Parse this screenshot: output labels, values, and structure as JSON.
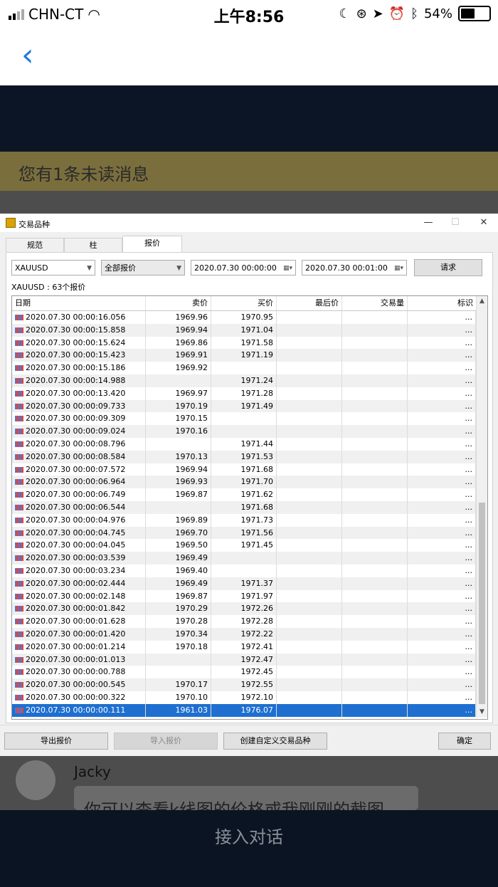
{
  "status": {
    "carrier": "CHN-CT",
    "time": "上午8:56",
    "battery": "54%",
    "battery_level": 0.54
  },
  "chat": {
    "banner": "您有1条未读消息",
    "username": "Jacky",
    "message": "你可以查看k线图的价格或我刚刚的截图",
    "bottom_action": "接入对话"
  },
  "dialog": {
    "title": "交易品种",
    "tabs": [
      {
        "label": "规范",
        "active": false
      },
      {
        "label": "柱",
        "active": false
      },
      {
        "label": "报价",
        "active": true
      }
    ],
    "symbol": "XAUUSD",
    "quote_type": "全部报价",
    "date_from": "2020.07.30 00:00:00",
    "date_to": "2020.07.30 00:01:00",
    "request_label": "请求",
    "count_text": "XAUUSD : 63个报价",
    "columns": [
      "日期",
      "卖价",
      "买价",
      "最后价",
      "交易量",
      "标识"
    ],
    "rows": [
      {
        "date": "2020.07.30 00:00:16.056",
        "bid": "1969.96",
        "ask": "1970.95",
        "flag": "..."
      },
      {
        "date": "2020.07.30 00:00:15.858",
        "bid": "1969.94",
        "ask": "1971.04",
        "flag": "..."
      },
      {
        "date": "2020.07.30 00:00:15.624",
        "bid": "1969.86",
        "ask": "1971.58",
        "flag": "..."
      },
      {
        "date": "2020.07.30 00:00:15.423",
        "bid": "1969.91",
        "ask": "1971.19",
        "flag": "..."
      },
      {
        "date": "2020.07.30 00:00:15.186",
        "bid": "1969.92",
        "ask": "",
        "flag": "..."
      },
      {
        "date": "2020.07.30 00:00:14.988",
        "bid": "",
        "ask": "1971.24",
        "flag": "..."
      },
      {
        "date": "2020.07.30 00:00:13.420",
        "bid": "1969.97",
        "ask": "1971.28",
        "flag": "..."
      },
      {
        "date": "2020.07.30 00:00:09.733",
        "bid": "1970.19",
        "ask": "1971.49",
        "flag": "..."
      },
      {
        "date": "2020.07.30 00:00:09.309",
        "bid": "1970.15",
        "ask": "",
        "flag": "..."
      },
      {
        "date": "2020.07.30 00:00:09.024",
        "bid": "1970.16",
        "ask": "",
        "flag": "..."
      },
      {
        "date": "2020.07.30 00:00:08.796",
        "bid": "",
        "ask": "1971.44",
        "flag": "..."
      },
      {
        "date": "2020.07.30 00:00:08.584",
        "bid": "1970.13",
        "ask": "1971.53",
        "flag": "..."
      },
      {
        "date": "2020.07.30 00:00:07.572",
        "bid": "1969.94",
        "ask": "1971.68",
        "flag": "..."
      },
      {
        "date": "2020.07.30 00:00:06.964",
        "bid": "1969.93",
        "ask": "1971.70",
        "flag": "..."
      },
      {
        "date": "2020.07.30 00:00:06.749",
        "bid": "1969.87",
        "ask": "1971.62",
        "flag": "..."
      },
      {
        "date": "2020.07.30 00:00:06.544",
        "bid": "",
        "ask": "1971.68",
        "flag": "..."
      },
      {
        "date": "2020.07.30 00:00:04.976",
        "bid": "1969.89",
        "ask": "1971.73",
        "flag": "..."
      },
      {
        "date": "2020.07.30 00:00:04.745",
        "bid": "1969.70",
        "ask": "1971.56",
        "flag": "..."
      },
      {
        "date": "2020.07.30 00:00:04.045",
        "bid": "1969.50",
        "ask": "1971.45",
        "flag": "..."
      },
      {
        "date": "2020.07.30 00:00:03.539",
        "bid": "1969.49",
        "ask": "",
        "flag": "..."
      },
      {
        "date": "2020.07.30 00:00:03.234",
        "bid": "1969.40",
        "ask": "",
        "flag": "..."
      },
      {
        "date": "2020.07.30 00:00:02.444",
        "bid": "1969.49",
        "ask": "1971.37",
        "flag": "..."
      },
      {
        "date": "2020.07.30 00:00:02.148",
        "bid": "1969.87",
        "ask": "1971.97",
        "flag": "..."
      },
      {
        "date": "2020.07.30 00:00:01.842",
        "bid": "1970.29",
        "ask": "1972.26",
        "flag": "..."
      },
      {
        "date": "2020.07.30 00:00:01.628",
        "bid": "1970.28",
        "ask": "1972.28",
        "flag": "..."
      },
      {
        "date": "2020.07.30 00:00:01.420",
        "bid": "1970.34",
        "ask": "1972.22",
        "flag": "..."
      },
      {
        "date": "2020.07.30 00:00:01.214",
        "bid": "1970.18",
        "ask": "1972.41",
        "flag": "..."
      },
      {
        "date": "2020.07.30 00:00:01.013",
        "bid": "",
        "ask": "1972.47",
        "flag": "..."
      },
      {
        "date": "2020.07.30 00:00:00.788",
        "bid": "",
        "ask": "1972.45",
        "flag": "..."
      },
      {
        "date": "2020.07.30 00:00:00.545",
        "bid": "1970.17",
        "ask": "1972.55",
        "flag": "..."
      },
      {
        "date": "2020.07.30 00:00:00.322",
        "bid": "1970.10",
        "ask": "1972.10",
        "flag": "..."
      },
      {
        "date": "2020.07.30 00:00:00.111",
        "bid": "1961.03",
        "ask": "1976.07",
        "flag": "...",
        "selected": true
      }
    ],
    "buttons": {
      "export": "导出报价",
      "import": "导入报价",
      "create": "创建自定义交易品种",
      "ok": "确定"
    }
  }
}
